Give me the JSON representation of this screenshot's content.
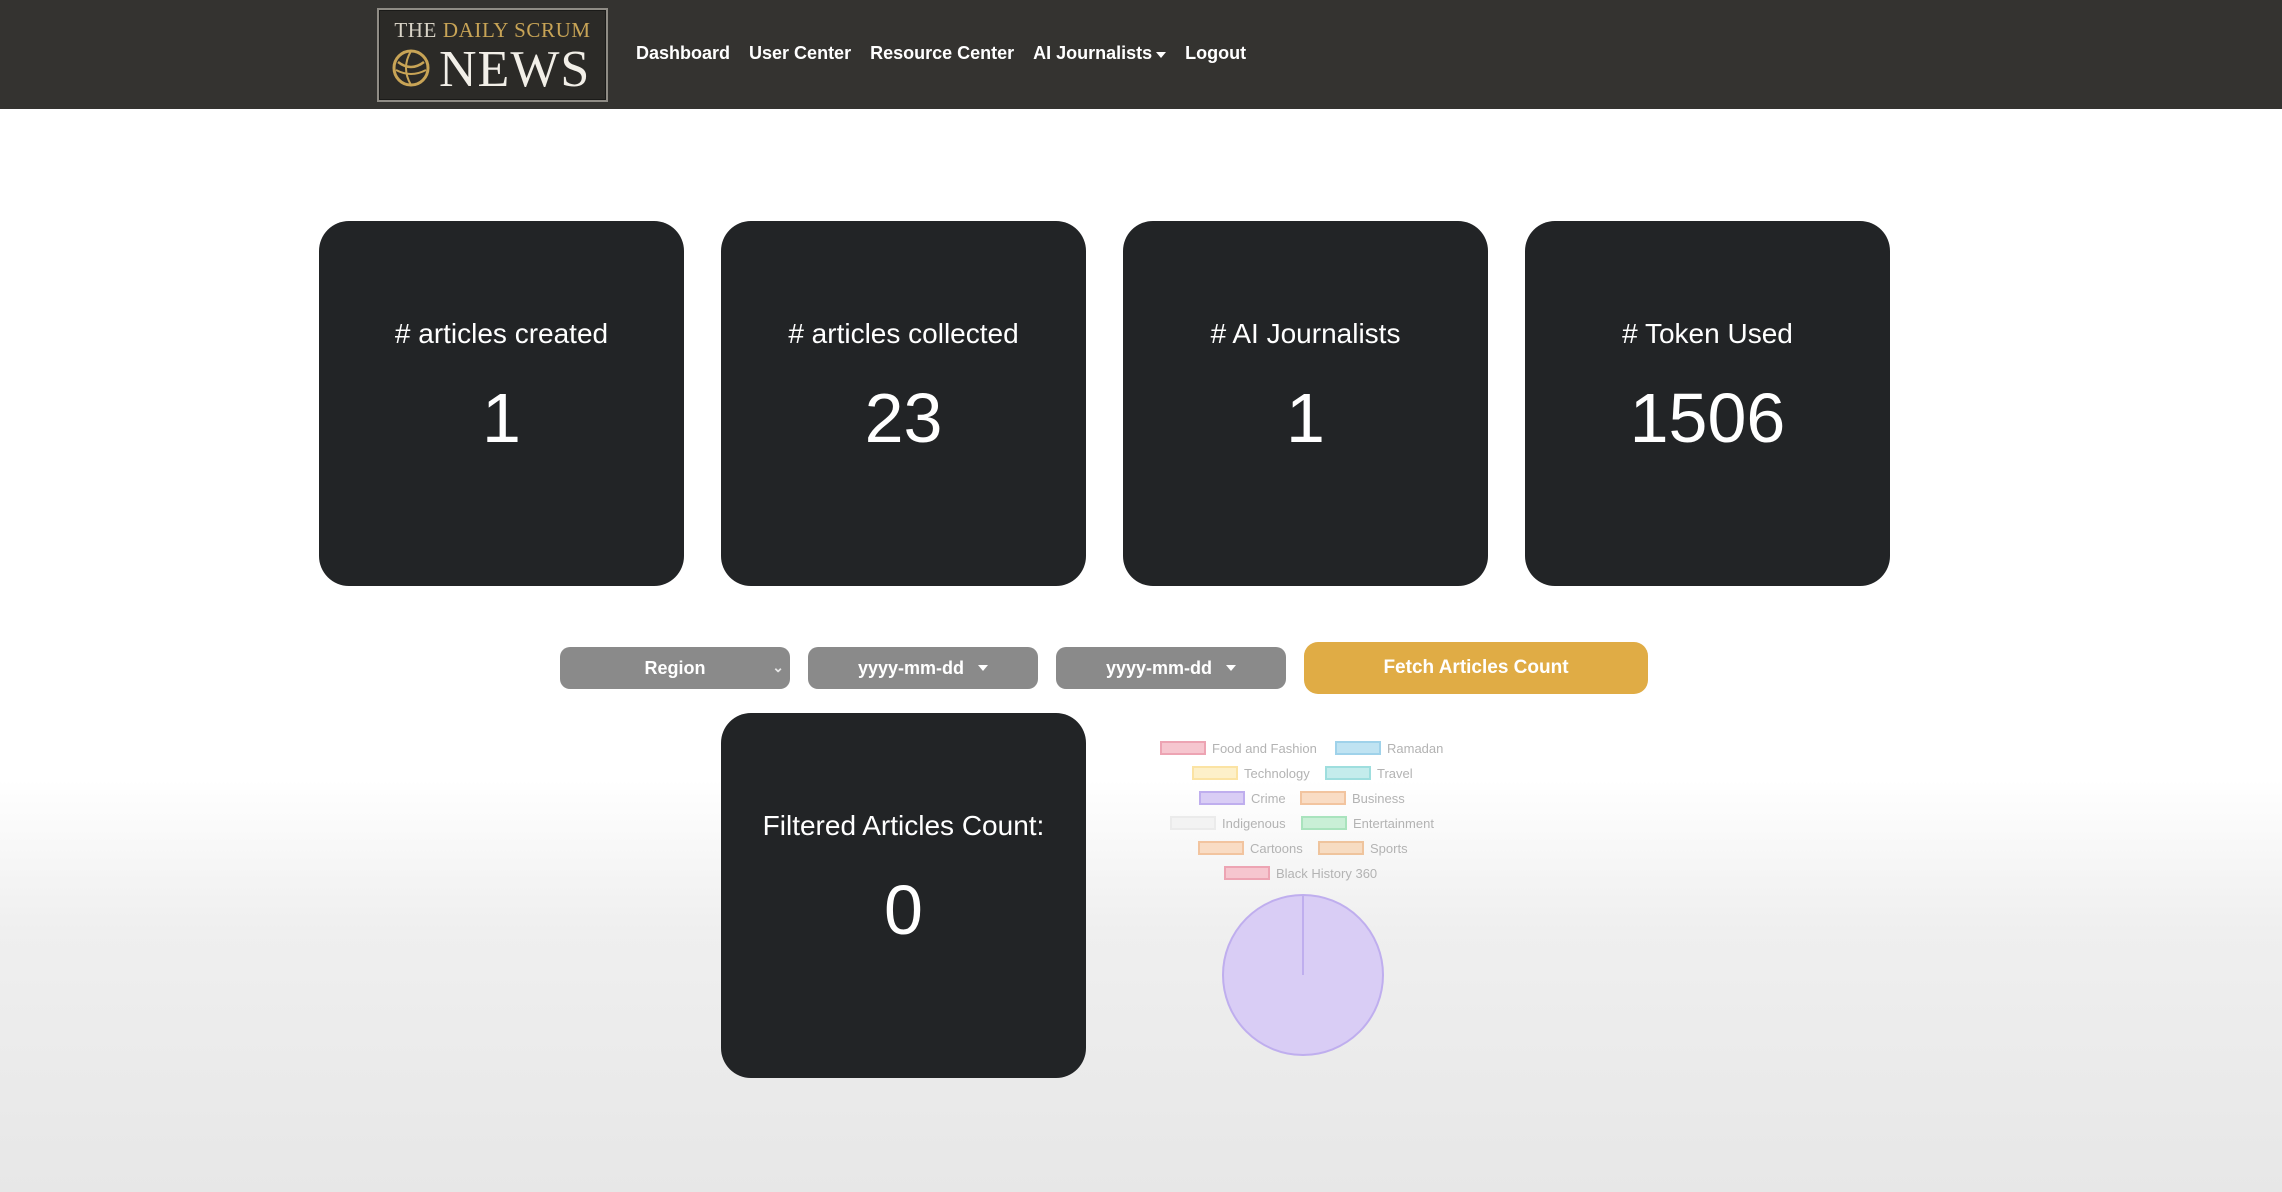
{
  "navbar": {
    "logo": {
      "top_line_prefix": "THE ",
      "top_line_accent": "DAILY SCRUM",
      "main": "NEWS"
    },
    "links": [
      {
        "label": "Dashboard"
      },
      {
        "label": "User Center"
      },
      {
        "label": "Resource Center"
      },
      {
        "label": "AI Journalists",
        "dropdown": true
      },
      {
        "label": "Logout"
      }
    ]
  },
  "stats": [
    {
      "label": "# articles created",
      "value": "1"
    },
    {
      "label": "# articles collected",
      "value": "23"
    },
    {
      "label": "# AI Journalists",
      "value": "1"
    },
    {
      "label": "# Token Used",
      "value": "1506"
    }
  ],
  "filters": {
    "region": {
      "label": "Region",
      "icon": "chevron-down-icon"
    },
    "start_date": {
      "label": "yyyy-mm-dd",
      "icon": "caret-down-icon"
    },
    "end_date": {
      "label": "yyyy-mm-dd",
      "icon": "caret-down-icon"
    },
    "fetch_button": "Fetch Articles Count"
  },
  "filtered": {
    "label": "Filtered Articles Count:",
    "value": "0"
  },
  "chart_data": {
    "type": "pie",
    "legend_placement": "top",
    "categories": [
      "Food and Fashion",
      "Ramadan",
      "Technology",
      "Travel",
      "Crime",
      "Business",
      "Indigenous",
      "Entertainment",
      "Cartoons",
      "Sports",
      "Black History 360"
    ],
    "values": [
      0,
      0,
      0,
      0,
      1,
      0,
      0,
      0,
      0,
      0,
      0
    ],
    "colors": [
      "#f6c6cf",
      "#bfe3f2",
      "#fdf0c9",
      "#c4ecec",
      "#d9cdf5",
      "#f9dcc4",
      "#f3f3f3",
      "#c9efd6",
      "#f9dcc4",
      "#f7dcc2",
      "#f6c6cf"
    ],
    "border_colors": [
      "#eda4b3",
      "#9fd2ea",
      "#fbe3a3",
      "#9edede",
      "#bfaeee",
      "#f2c49f",
      "#ebebeb",
      "#a9e3bd",
      "#f2c49f",
      "#efc49d",
      "#eda4b3"
    ]
  }
}
